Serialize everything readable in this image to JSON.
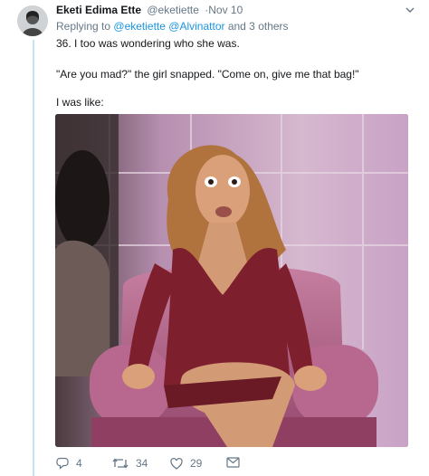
{
  "tweet": {
    "author_name": "Eketi Edima Ette",
    "author_handle": "@eketiette",
    "timestamp": "·Nov 10",
    "replying_prefix": "Replying to",
    "replying_to_1": "@eketiette",
    "replying_to_2": "@Alvinattor",
    "replying_suffix": "and 3 others",
    "line1": "36. I too was wondering who she was.",
    "line2": "\"Are you mad?\" the girl snapped. \"Come on, give me that bag!\"",
    "line3": "I was like:"
  },
  "actions": {
    "reply_count": "4",
    "retweet_count": "34",
    "like_count": "29"
  },
  "icons": {
    "menu": "chevron-down-icon",
    "reply": "reply-icon",
    "retweet": "retweet-icon",
    "like": "heart-icon",
    "dm": "envelope-icon"
  },
  "colors": {
    "link": "#1b95e0",
    "muted": "#657786",
    "thread": "#c4e3f7"
  }
}
